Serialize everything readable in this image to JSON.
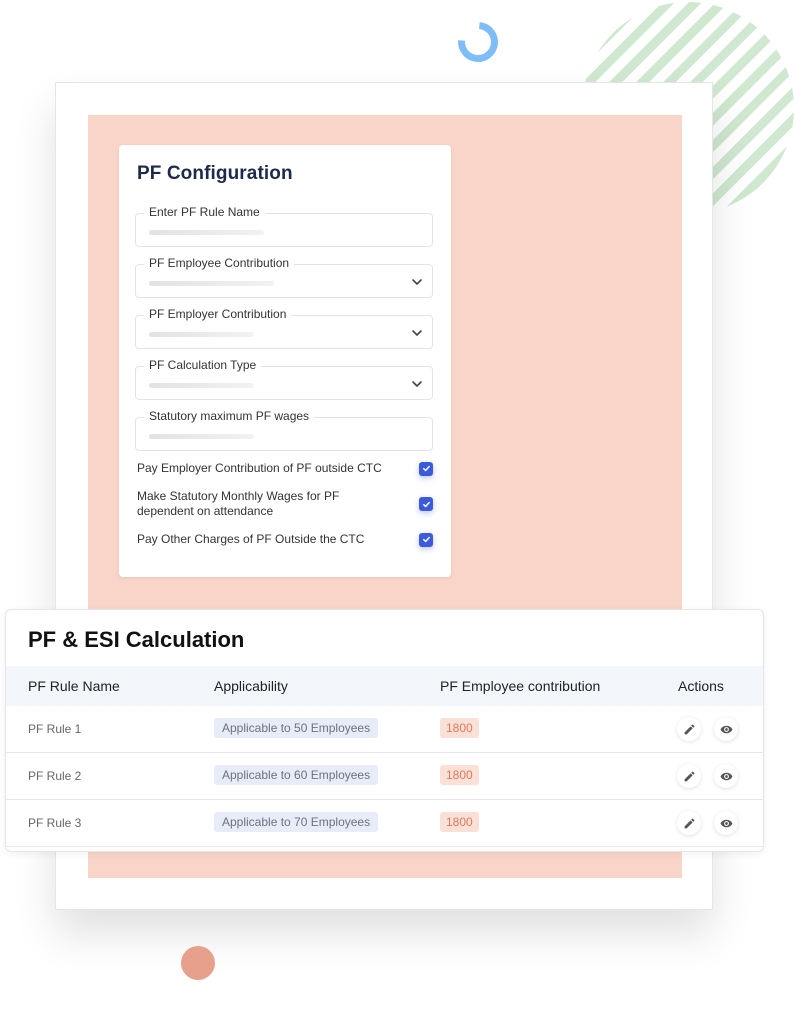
{
  "config": {
    "title": "PF Configuration",
    "fields": [
      {
        "label": "Enter PF Rule Name",
        "type": "text",
        "value": ""
      },
      {
        "label": "PF Employee Contribution",
        "type": "select",
        "value": ""
      },
      {
        "label": "PF Employer Contribution",
        "type": "select",
        "value": ""
      },
      {
        "label": "PF Calculation Type",
        "type": "select",
        "value": ""
      },
      {
        "label": "Statutory maximum PF wages",
        "type": "text",
        "value": ""
      }
    ],
    "checkboxes": [
      {
        "label": "Pay Employer Contribution of PF outside CTC",
        "checked": true
      },
      {
        "label": "Make Statutory Monthly Wages for PF dependent on attendance",
        "checked": true
      },
      {
        "label": "Pay Other Charges of PF Outside the CTC",
        "checked": true
      }
    ]
  },
  "table": {
    "title": "PF & ESI Calculation",
    "columns": [
      "PF Rule Name",
      "Applicability",
      "PF Employee contribution",
      "Actions"
    ],
    "rows": [
      {
        "name": "PF Rule 1",
        "applicability": "Applicable to 50 Employees",
        "contribution": "1800",
        "actions": [
          "edit-icon",
          "eye-icon"
        ]
      },
      {
        "name": "PF Rule 2",
        "applicability": "Applicable to 60 Employees",
        "contribution": "1800",
        "actions": [
          "edit-icon",
          "eye-icon"
        ]
      },
      {
        "name": "PF Rule 3",
        "applicability": "Applicable to 70 Employees",
        "contribution": "1800",
        "actions": [
          "edit-icon",
          "eye-icon"
        ]
      }
    ]
  },
  "colors": {
    "accent_checkbox": "#3c5bdc",
    "panel_peach": "#f9d5c9",
    "contribution_pill_text": "#e0795d",
    "applicability_pill_bg": "#e8ebf8",
    "table_header_bg": "#f3f7fc",
    "decor_ring_blue": "#7fbdf8",
    "decor_stripes_green": "#cfe8cf",
    "decor_dot": "#e7a08c"
  }
}
